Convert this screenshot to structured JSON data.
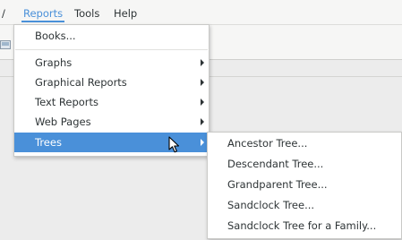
{
  "menubar": {
    "partial_item": "/",
    "items": [
      {
        "label": "Reports"
      },
      {
        "label": "Tools"
      },
      {
        "label": "Help"
      }
    ]
  },
  "reports_menu": {
    "items": [
      {
        "label": "Books..."
      },
      {
        "label": "Graphs"
      },
      {
        "label": "Graphical Reports"
      },
      {
        "label": "Text Reports"
      },
      {
        "label": "Web Pages"
      },
      {
        "label": "Trees"
      }
    ]
  },
  "trees_menu": {
    "items": [
      {
        "label": "Ancestor Tree..."
      },
      {
        "label": "Descendant Tree..."
      },
      {
        "label": "Grandparent Tree..."
      },
      {
        "label": "Sandclock Tree..."
      },
      {
        "label": "Sandclock Tree for a Family..."
      }
    ]
  },
  "colors": {
    "accent": "#4a90d9",
    "menu_background": "#ffffff",
    "window_background": "#ececec",
    "text": "#2e3436"
  },
  "icons": {
    "toolbar": "toolbar-image-icon",
    "submenu": "chevron-right-icon",
    "cursor": "mouse-pointer-icon"
  }
}
